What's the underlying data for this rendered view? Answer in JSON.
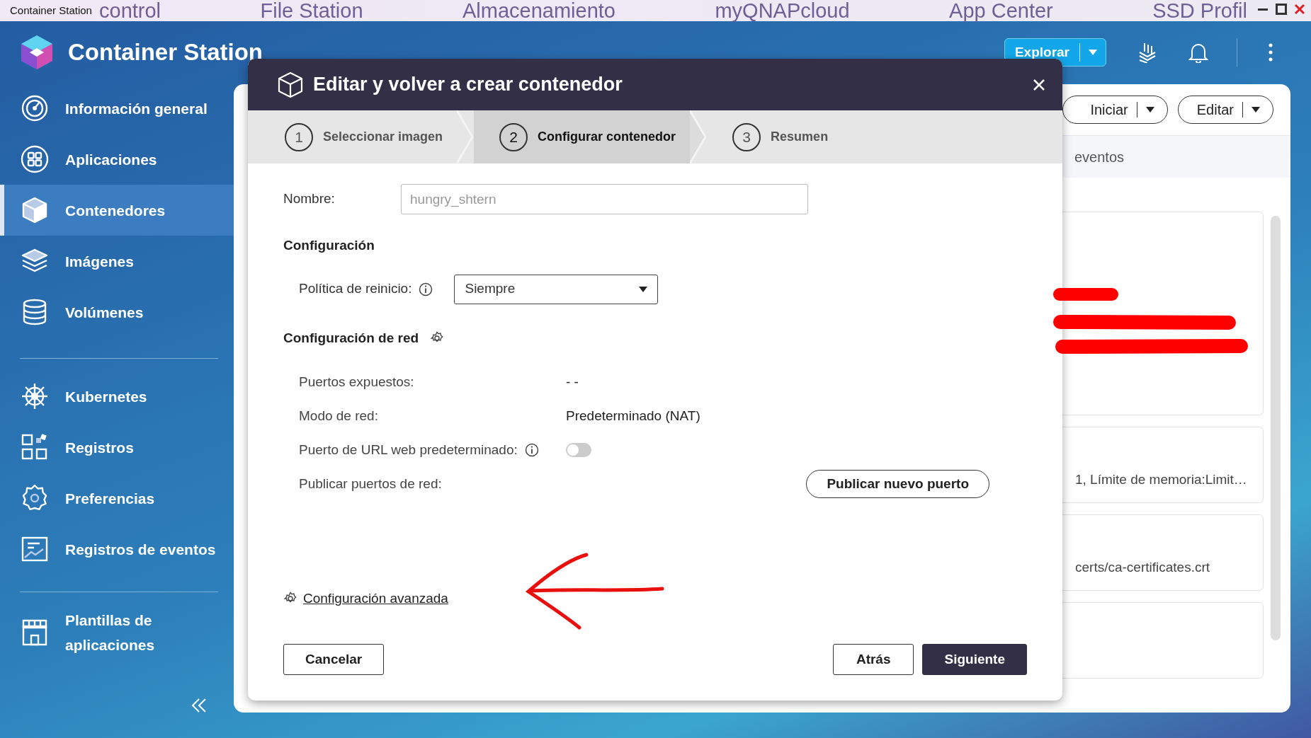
{
  "os_bar": {
    "title": "Container Station",
    "background_tabs": [
      "control",
      "File Station",
      "Almacenamiento",
      "myQNAPcloud",
      "App Center",
      "SSD Profil"
    ]
  },
  "header": {
    "app_title": "Container Station",
    "explore_button": "Explorar"
  },
  "sidebar": {
    "groups": [
      [
        {
          "label": "Información general",
          "kind": "gauge",
          "selected": false
        },
        {
          "label": "Aplicaciones",
          "kind": "apps",
          "selected": false
        },
        {
          "label": "Contenedores",
          "kind": "cube",
          "selected": true
        },
        {
          "label": "Imágenes",
          "kind": "layers",
          "selected": false
        },
        {
          "label": "Volúmenes",
          "kind": "database",
          "selected": false
        }
      ],
      [
        {
          "label": "Kubernetes",
          "kind": "helm",
          "selected": false
        },
        {
          "label": "Registros",
          "kind": "registry",
          "selected": false
        },
        {
          "label": "Preferencias",
          "kind": "gear",
          "selected": false
        },
        {
          "label": "Registros de eventos",
          "kind": "chart",
          "selected": false
        }
      ],
      [
        {
          "label": "Plantillas de aplicaciones",
          "kind": "store",
          "selected": false
        }
      ]
    ]
  },
  "background": {
    "buttons": [
      "Iniciar",
      "Editar"
    ],
    "tab": "eventos",
    "cards": [
      {
        "kind": "blank"
      },
      {
        "kind": "text",
        "text": "1, Límite de memoria:Limit…"
      },
      {
        "kind": "text",
        "text": "certs/ca-certificates.crt"
      },
      {
        "kind": "blank"
      }
    ]
  },
  "dialog": {
    "title": "Editar y volver a crear contenedor",
    "steps": [
      {
        "number": "1",
        "label": "Seleccionar imagen",
        "selected": false
      },
      {
        "number": "2",
        "label": "Configurar contenedor",
        "selected": true
      },
      {
        "number": "3",
        "label": "Resumen",
        "selected": false
      }
    ],
    "name_label": "Nombre:",
    "name_value": "hungry_shtern",
    "name_disabled": true,
    "section_title": "Configuración",
    "restart_label": "Política de reinicio:",
    "restart_value": "Siempre",
    "network_title": "Configuración de red",
    "rows": [
      {
        "label": "Puertos expuestos:",
        "kind": "text",
        "info": false,
        "value": "- -"
      },
      {
        "label": "Modo de red:",
        "kind": "text",
        "info": false,
        "value": "Predeterminado (NAT)"
      },
      {
        "label": "Puerto de URL web predeterminado:",
        "kind": "toggle",
        "info": true,
        "on": false
      },
      {
        "label": "Publicar puertos de red:",
        "kind": "button",
        "info": false,
        "button": "Publicar nuevo puerto"
      }
    ],
    "advanced_link": "Configuración avanzada",
    "cancel": "Cancelar",
    "back": "Atrás",
    "next": "Siguiente"
  }
}
